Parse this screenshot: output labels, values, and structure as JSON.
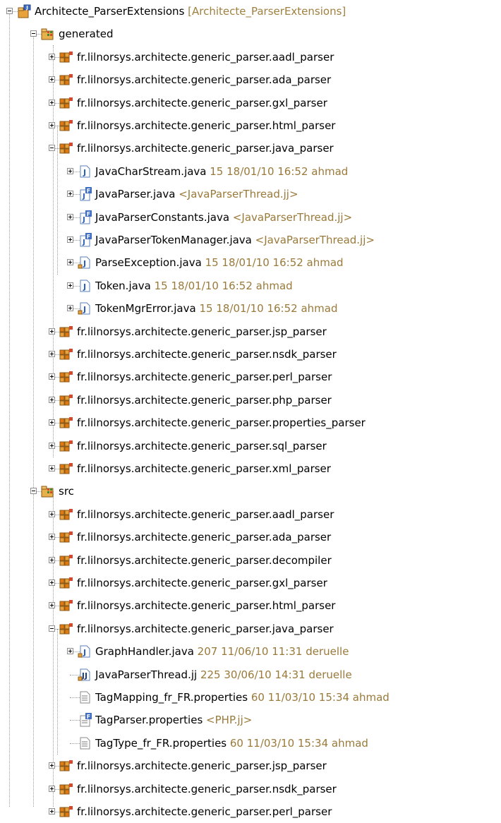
{
  "project": {
    "name": "Architecte_ParserExtensions",
    "decoration": "[Architecte_ParserExtensions]"
  },
  "generated": {
    "label": "generated",
    "packages": [
      "fr.lilnorsys.architecte.generic_parser.aadl_parser",
      "fr.lilnorsys.architecte.generic_parser.ada_parser",
      "fr.lilnorsys.architecte.generic_parser.gxl_parser",
      "fr.lilnorsys.architecte.generic_parser.html_parser",
      "fr.lilnorsys.architecte.generic_parser.java_parser"
    ],
    "java_parser_files": [
      {
        "name": "JavaCharStream.java",
        "decoration": "15  18/01/10 16:52  ahmad"
      },
      {
        "name": "JavaParser.java",
        "decoration": "<JavaParserThread.jj>"
      },
      {
        "name": "JavaParserConstants.java",
        "decoration": "<JavaParserThread.jj>"
      },
      {
        "name": "JavaParserTokenManager.java",
        "decoration": "<JavaParserThread.jj>"
      },
      {
        "name": "ParseException.java",
        "decoration": "15  18/01/10 16:52  ahmad"
      },
      {
        "name": "Token.java",
        "decoration": "15  18/01/10 16:52  ahmad"
      },
      {
        "name": "TokenMgrError.java",
        "decoration": "15  18/01/10 16:52  ahmad"
      }
    ],
    "more_packages": [
      "fr.lilnorsys.architecte.generic_parser.jsp_parser",
      "fr.lilnorsys.architecte.generic_parser.nsdk_parser",
      "fr.lilnorsys.architecte.generic_parser.perl_parser",
      "fr.lilnorsys.architecte.generic_parser.php_parser",
      "fr.lilnorsys.architecte.generic_parser.properties_parser",
      "fr.lilnorsys.architecte.generic_parser.sql_parser",
      "fr.lilnorsys.architecte.generic_parser.xml_parser"
    ]
  },
  "src": {
    "label": "src",
    "packages": [
      "fr.lilnorsys.architecte.generic_parser.aadl_parser",
      "fr.lilnorsys.architecte.generic_parser.ada_parser",
      "fr.lilnorsys.architecte.generic_parser.decompiler",
      "fr.lilnorsys.architecte.generic_parser.gxl_parser",
      "fr.lilnorsys.architecte.generic_parser.html_parser",
      "fr.lilnorsys.architecte.generic_parser.java_parser"
    ],
    "java_parser_files": [
      {
        "name": "GraphHandler.java",
        "decoration": "207  11/06/10 11:31  deruelle"
      },
      {
        "name": "JavaParserThread.jj",
        "decoration": "225  30/06/10 14:31  deruelle"
      },
      {
        "name": "TagMapping_fr_FR.properties",
        "decoration": "60  11/03/10 15:34  ahmad"
      },
      {
        "name": "TagParser.properties",
        "decoration": "<PHP.jj>"
      },
      {
        "name": "TagType_fr_FR.properties",
        "decoration": "60  11/03/10 15:34  ahmad"
      }
    ],
    "more_packages": [
      "fr.lilnorsys.architecte.generic_parser.jsp_parser",
      "fr.lilnorsys.architecte.generic_parser.nsdk_parser",
      "fr.lilnorsys.architecte.generic_parser.perl_parser"
    ]
  },
  "colors": {
    "decoration": "#a08040",
    "package_orange": "#e07a10",
    "package_brown": "#8b5a1a",
    "java_blue": "#2c5fb8",
    "folder_green": "#3a8a3a",
    "tree_line": "#9a9a9a"
  },
  "icons": {
    "project": "java-project-icon",
    "source_folder": "source-folder-icon",
    "package": "package-icon",
    "java_file": "java-file-icon",
    "generated_java_file": "generated-java-file-icon",
    "javacc_file": "javacc-file-icon",
    "properties_file": "properties-file-icon",
    "generated_properties_file": "generated-properties-file-icon"
  }
}
